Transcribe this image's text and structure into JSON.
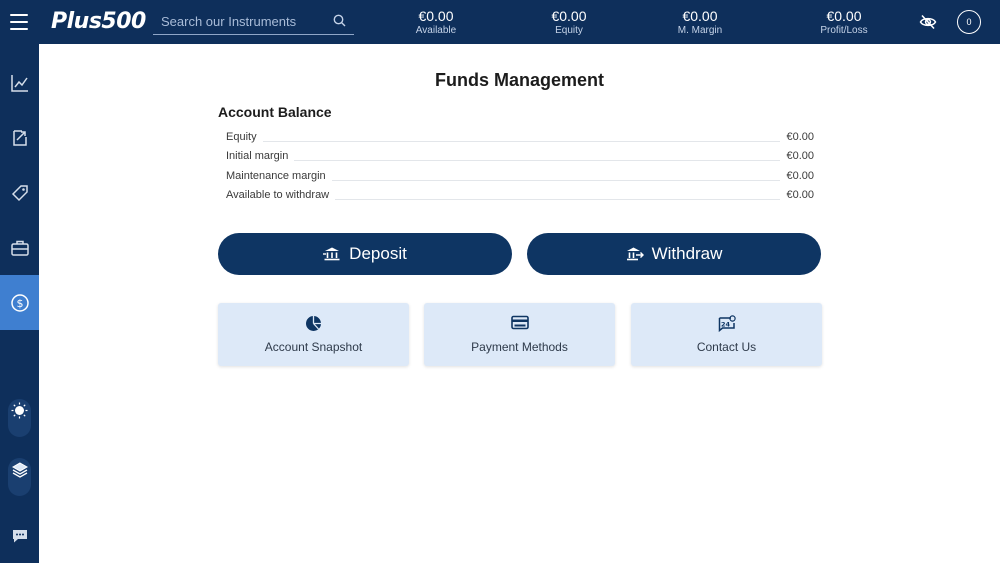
{
  "header": {
    "logo": "Plus500",
    "search_placeholder": "Search our Instruments",
    "stats": [
      {
        "value": "€0.00",
        "label": "Available"
      },
      {
        "value": "€0.00",
        "label": "Equity"
      },
      {
        "value": "€0.00",
        "label": "M. Margin"
      },
      {
        "value": "€0.00",
        "label": "Profit/Loss"
      }
    ],
    "notification_count": "0"
  },
  "sidebar": {
    "items": [
      {
        "icon": "chart-icon"
      },
      {
        "icon": "trades-icon"
      },
      {
        "icon": "tag-icon"
      },
      {
        "icon": "briefcase-icon"
      },
      {
        "icon": "funds-icon",
        "active": true
      }
    ],
    "toggles": [
      {
        "icon": "sun-icon"
      },
      {
        "icon": "layers-icon"
      }
    ],
    "chat_icon": "chat-icon"
  },
  "page": {
    "title": "Funds Management",
    "account_balance_title": "Account Balance",
    "balance_rows": [
      {
        "label": "Equity",
        "value": "€0.00"
      },
      {
        "label": "Initial margin",
        "value": "€0.00"
      },
      {
        "label": "Maintenance margin",
        "value": "€0.00"
      },
      {
        "label": "Available to withdraw",
        "value": "€0.00"
      }
    ],
    "deposit_label": "Deposit",
    "withdraw_label": "Withdraw",
    "cards": [
      {
        "label": "Account Snapshot",
        "icon": "pie-chart-icon"
      },
      {
        "label": "Payment Methods",
        "icon": "credit-card-icon"
      },
      {
        "label": "Contact Us",
        "icon": "support-24-icon"
      }
    ]
  },
  "colors": {
    "navy": "#0e2f5b",
    "button": "#0e3563",
    "active": "#3f7fd0",
    "card": "#dde9f8"
  }
}
